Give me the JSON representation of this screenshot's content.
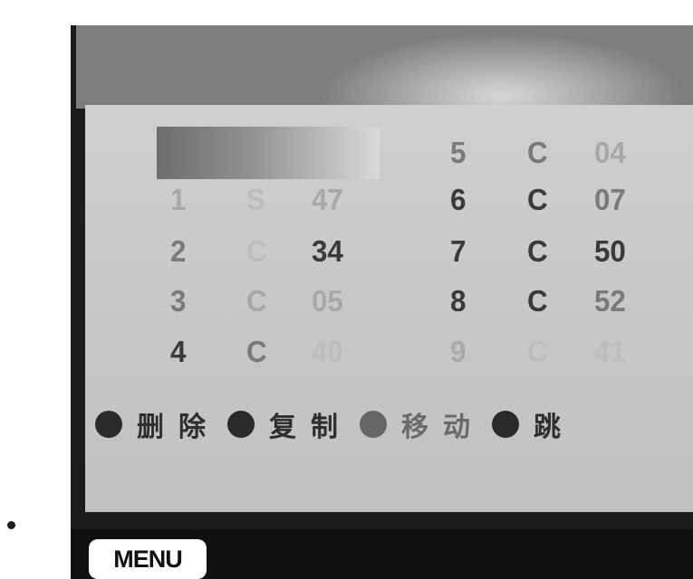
{
  "channel_list": {
    "rows": [
      {
        "num": "1",
        "mode": "S",
        "channel": "47"
      },
      {
        "num": "2",
        "mode": "C",
        "channel": "34"
      },
      {
        "num": "3",
        "mode": "C",
        "channel": "05"
      },
      {
        "num": "4",
        "mode": "C",
        "channel": "40"
      },
      {
        "num": "5",
        "mode": "C",
        "channel": "04"
      },
      {
        "num": "6",
        "mode": "C",
        "channel": "07"
      },
      {
        "num": "7",
        "mode": "C",
        "channel": "50"
      },
      {
        "num": "8",
        "mode": "C",
        "channel": "52"
      },
      {
        "num": "9",
        "mode": "C",
        "channel": "41"
      }
    ]
  },
  "actions": [
    {
      "label": "删除"
    },
    {
      "label": "复制"
    },
    {
      "label": "移动"
    },
    {
      "label": "跳"
    }
  ],
  "footer": {
    "menu_label": "MENU"
  },
  "colors": {
    "panel": "#c8c8c8",
    "frame": "#1c1c1c",
    "text": "#3a3a3a"
  }
}
